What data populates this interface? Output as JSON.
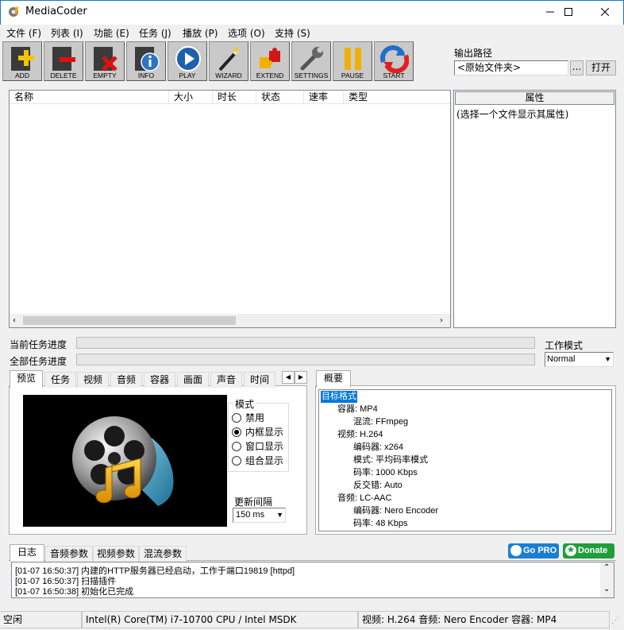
{
  "window": {
    "title": "MediaCoder"
  },
  "menu": [
    "文件 (F)",
    "列表 (I)",
    "功能 (E)",
    "任务 (J)",
    "播放 (P)",
    "选项 (O)",
    "支持 (S)"
  ],
  "toolbar": [
    "ADD",
    "DELETE",
    "EMPTY",
    "INFO",
    "PLAY",
    "WIZARD",
    "EXTEND",
    "SETTINGS",
    "PAUSE",
    "START"
  ],
  "output": {
    "label": "输出路径",
    "value": "<原始文件夹>",
    "browse_label": "...",
    "open_label": "打开"
  },
  "filelist": {
    "columns": [
      "名称",
      "大小",
      "时长",
      "状态",
      "速率",
      "类型"
    ]
  },
  "properties": {
    "header": "属性",
    "hint": "(选择一个文件显示其属性)"
  },
  "progress": {
    "current_label": "当前任务进度",
    "all_label": "全部任务进度",
    "current": 0,
    "all": 0
  },
  "workmode": {
    "label": "工作模式",
    "value": "Normal"
  },
  "preview_tabs": [
    "预览",
    "任务",
    "视频",
    "音频",
    "容器",
    "画面",
    "声音",
    "时间"
  ],
  "preview": {
    "mode_label": "模式",
    "modes": [
      "禁用",
      "内框显示",
      "窗口显示",
      "组合显示"
    ],
    "selected_mode": "内框显示",
    "interval_label": "更新间隔",
    "interval_value": "150 ms"
  },
  "summary": {
    "tab": "概要",
    "tree": [
      {
        "text": "目标格式",
        "level": 0,
        "selected": true
      },
      {
        "text": "容器: MP4",
        "level": 1
      },
      {
        "text": "混流: FFmpeg",
        "level": 2
      },
      {
        "text": "视频: H.264",
        "level": 1
      },
      {
        "text": "编码器: x264",
        "level": 2
      },
      {
        "text": "模式: 平均码率模式",
        "level": 2
      },
      {
        "text": "码率: 1000 Kbps",
        "level": 2
      },
      {
        "text": "反交错: Auto",
        "level": 2
      },
      {
        "text": "音频: LC-AAC",
        "level": 1
      },
      {
        "text": "编码器: Nero Encoder",
        "level": 2
      },
      {
        "text": "码率: 48 Kbps",
        "level": 2
      }
    ]
  },
  "log_tabs": [
    "日志",
    "音频参数",
    "视频参数",
    "混流参数"
  ],
  "badges": {
    "gopro": "Go PRO",
    "donate": "Donate"
  },
  "log": [
    "[01-07 16:50:37] 内建的HTTP服务器已经启动，工作于端口19819 [httpd]",
    "[01-07 16:50:37] 扫描插件",
    "[01-07 16:50:38] 初始化已完成"
  ],
  "statusbar": {
    "state": "空闲",
    "cpu": "Intel(R) Core(TM) i7-10700 CPU  / Intel MSDK",
    "format": "视频: H.264  音频: Nero Encoder  容器: MP4"
  },
  "colors": {
    "titlebar_border": "#1979ca",
    "selection": "#0078d7",
    "gopro": "#1a7fd4",
    "donate": "#1f9e3a"
  }
}
